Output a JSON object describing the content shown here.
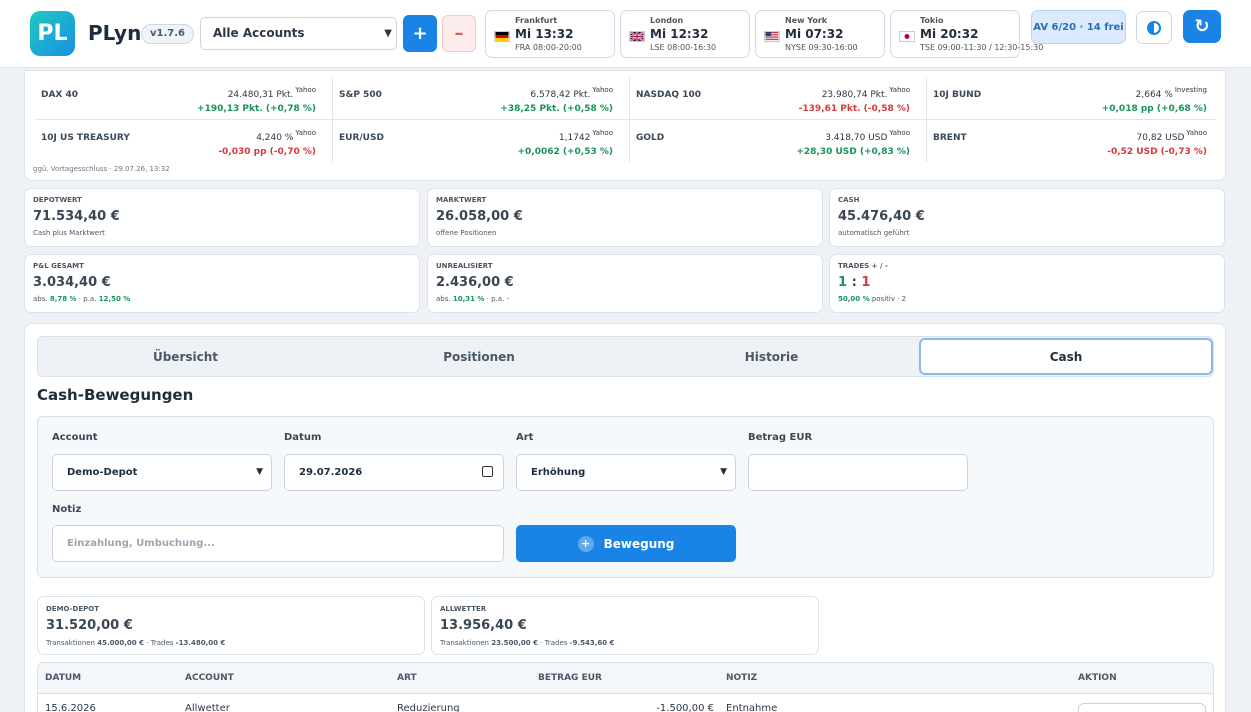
{
  "header": {
    "app_name": "PLyn",
    "logo_text": "PL",
    "version": "v1.7.6",
    "account_select": "Alle Accounts",
    "add_label": "+",
    "remove_label": "–",
    "clocks": [
      {
        "city": "Frankfurt",
        "time": "Mi 13:32",
        "hours": "FRA 08:00-20:00",
        "flag": "de"
      },
      {
        "city": "London",
        "time": "Mi 12:32",
        "hours": "LSE 08:00-16:30",
        "flag": "gb"
      },
      {
        "city": "New York",
        "time": "Mi 07:32",
        "hours": "NYSE 09:30-16:00",
        "flag": "us"
      },
      {
        "city": "Tokio",
        "time": "Mi 20:32",
        "hours": "TSE 09:00-11:30 / 12:30-15:30",
        "flag": "jp"
      }
    ],
    "av_badge": "AV 6/20 · 14 frei",
    "theme_icon": "contrast-icon",
    "refresh_icon": "refresh-icon"
  },
  "markets": {
    "items": [
      {
        "name": "DAX 40",
        "value": "24.480,31 Pkt.",
        "source": "Yahoo",
        "change": "+190,13 Pkt. (+0,78 %)",
        "dir": "pos"
      },
      {
        "name": "S&P 500",
        "value": "6.578,42 Pkt.",
        "source": "Yahoo",
        "change": "+38,25 Pkt. (+0,58 %)",
        "dir": "pos"
      },
      {
        "name": "NASDAQ 100",
        "value": "23.980,74 Pkt.",
        "source": "Yahoo",
        "change": "-139,61 Pkt. (-0,58 %)",
        "dir": "neg"
      },
      {
        "name": "10J BUND",
        "value": "2,664 %",
        "source": "Investing",
        "change": "+0,018 pp (+0,68 %)",
        "dir": "pos"
      },
      {
        "name": "10J US TREASURY",
        "value": "4,240 %",
        "source": "Yahoo",
        "change": "-0,030 pp (-0,70 %)",
        "dir": "neg"
      },
      {
        "name": "EUR/USD",
        "value": "1,1742",
        "source": "Yahoo",
        "change": "+0,0062 (+0,53 %)",
        "dir": "pos"
      },
      {
        "name": "GOLD",
        "value": "3.418,70 USD",
        "source": "Yahoo",
        "change": "+28,30 USD (+0,83 %)",
        "dir": "pos"
      },
      {
        "name": "BRENT",
        "value": "70,82 USD",
        "source": "Yahoo",
        "change": "-0,52 USD (-0,73 %)",
        "dir": "neg"
      }
    ],
    "note": "ggü. Vortagesschluss · 29.07.26, 13:32"
  },
  "kpis": [
    {
      "label": "DEPOTWERT",
      "value": "71.534,40 €",
      "sub": "Cash plus Marktwert",
      "color": "#3a4654"
    },
    {
      "label": "MARKTWERT",
      "value": "26.058,00 €",
      "sub": "offene Positionen",
      "color": "#3a4654"
    },
    {
      "label": "CASH",
      "value": "45.476,40 €",
      "sub": "automatisch geführt",
      "color": "#3a4654"
    },
    {
      "label": "P&L GESAMT",
      "value": "3.034,40 €",
      "sub_prefix": "abs. ",
      "sub_a": "8,78 %",
      "sub_mid": " · p.a. ",
      "sub_b": "12,50 %",
      "color": "#19935a"
    },
    {
      "label": "UNREALISIERT",
      "value": "2.436,00 €",
      "sub_prefix": "abs. ",
      "sub_a": "10,31 %",
      "sub_mid": " · p.a. -",
      "sub_b": "",
      "color": "#19935a"
    },
    {
      "label": "TRADES + / -",
      "value_a": "1",
      "value_sep": " : ",
      "value_b": "1",
      "sub_a": "50,00 %",
      "sub_mid": " positiv · 2"
    }
  ],
  "tabs": [
    {
      "label": "Übersicht",
      "active": false
    },
    {
      "label": "Positionen",
      "active": false
    },
    {
      "label": "Historie",
      "active": false
    },
    {
      "label": "Cash",
      "active": true
    }
  ],
  "cash": {
    "title": "Cash-Bewegungen",
    "form": {
      "account_label": "Account",
      "account_value": "Demo-Depot",
      "date_label": "Datum",
      "date_value": "29.07.2026",
      "type_label": "Art",
      "type_value": "Erhöhung",
      "amount_label": "Betrag EUR",
      "amount_value": "",
      "note_label": "Notiz",
      "note_placeholder": "Einzahlung, Umbuchung...",
      "submit_label": "Bewegung"
    },
    "accounts": [
      {
        "label": "DEMO-DEPOT",
        "value": "31.520,00 €",
        "tx_label": "Transaktionen ",
        "tx": "45.000,00 €",
        "tr_label": " · Trades ",
        "tr": "-13.480,00 €"
      },
      {
        "label": "ALLWETTER",
        "value": "13.956,40 €",
        "tx_label": "Transaktionen ",
        "tx": "23.500,00 €",
        "tr_label": " · Trades ",
        "tr": "-9.543,60 €"
      }
    ],
    "table": {
      "headers": [
        "DATUM",
        "ACCOUNT",
        "ART",
        "BETRAG EUR",
        "NOTIZ",
        "AKTION"
      ],
      "rows": [
        {
          "date": "15.6.2026",
          "account": "Allwetter",
          "type": "Reduzierung",
          "amount": "-1.500,00 €",
          "note": "Entnahme"
        }
      ]
    }
  }
}
